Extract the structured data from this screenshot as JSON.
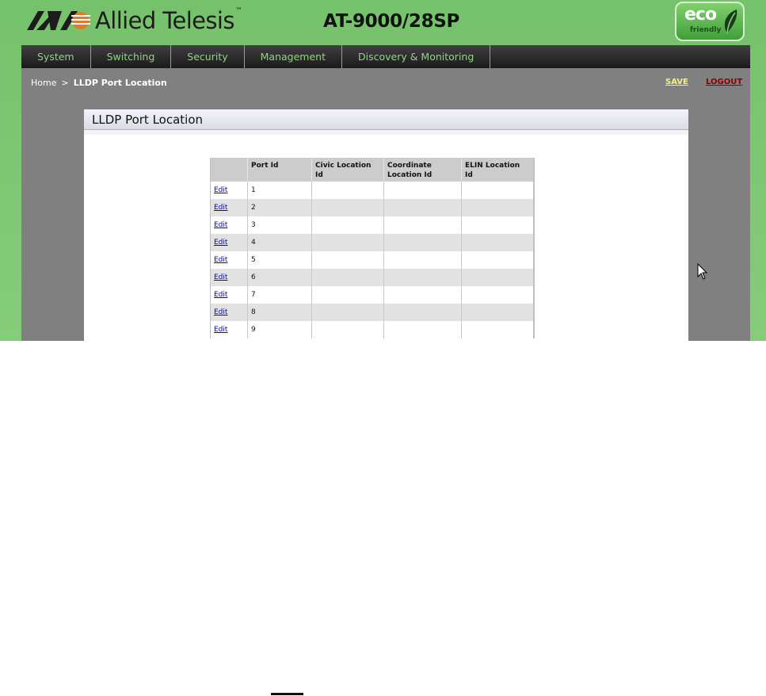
{
  "header": {
    "brand": "Allied Telesis",
    "trademark": "™",
    "model": "AT-9000/28SP",
    "badge": {
      "main": "eco",
      "sub": "friendly"
    }
  },
  "nav": {
    "items": [
      "System",
      "Switching",
      "Security",
      "Management",
      "Discovery & Monitoring"
    ]
  },
  "breadcrumb": {
    "home": "Home",
    "separator": ">",
    "current": "LLDP Port Location"
  },
  "actions": {
    "save": "SAVE",
    "logout": "LOGOUT"
  },
  "panel": {
    "title": "LLDP Port Location"
  },
  "table": {
    "headers": [
      "",
      "Port Id",
      "Civic Location Id",
      "Coordinate Location Id",
      "ELIN Location Id"
    ],
    "edit_label": "Edit",
    "rows": [
      {
        "port": "1",
        "civic": "",
        "coordinate": "",
        "elin": ""
      },
      {
        "port": "2",
        "civic": "",
        "coordinate": "",
        "elin": ""
      },
      {
        "port": "3",
        "civic": "",
        "coordinate": "",
        "elin": ""
      },
      {
        "port": "4",
        "civic": "",
        "coordinate": "",
        "elin": ""
      },
      {
        "port": "5",
        "civic": "",
        "coordinate": "",
        "elin": ""
      },
      {
        "port": "6",
        "civic": "",
        "coordinate": "",
        "elin": ""
      },
      {
        "port": "7",
        "civic": "",
        "coordinate": "",
        "elin": ""
      },
      {
        "port": "8",
        "civic": "",
        "coordinate": "",
        "elin": ""
      },
      {
        "port": "9",
        "civic": "",
        "coordinate": "",
        "elin": ""
      }
    ]
  },
  "colors": {
    "header_green": "#7dc573",
    "nav_text": "#8ed67f",
    "content_grey": "#808080",
    "save": "#f6f080",
    "logout": "#8b0000",
    "link": "#0000cc"
  }
}
